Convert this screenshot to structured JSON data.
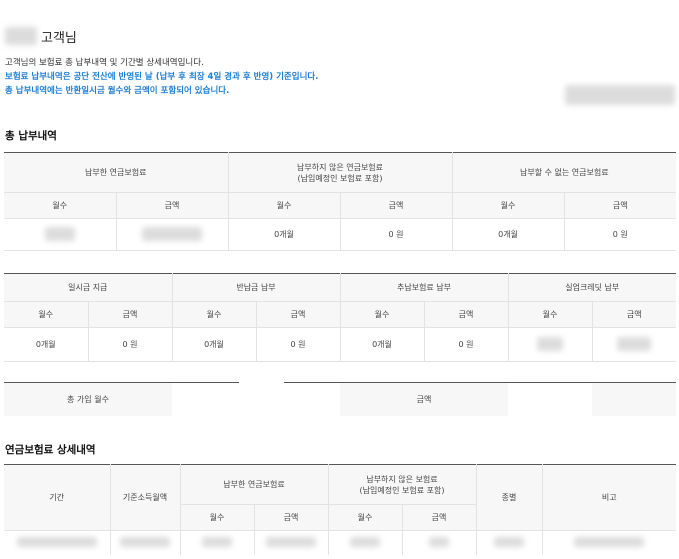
{
  "greeting": {
    "suffix": "고객님"
  },
  "intro": {
    "line1": "고객님의 보험료 총 납부내역 및 기간별 상세내역입니다.",
    "line2": "보험료 납부내역은 공단 전산에 반영된 날 (납부 후 최장 4일 경과 후 반영) 기준입니다.",
    "line3": "총 납부내역에는 반환일시금 월수와 금액이 포함되어 있습니다."
  },
  "total_section": {
    "title": "총 납부내역",
    "table1": {
      "groups": [
        "납부한 연금보험료",
        "납부하지 않은 연금보험료",
        "(납입예정인 보험료 포함)",
        "납부할 수 없는 연금보험료"
      ],
      "sub": {
        "months": "월수",
        "amount": "금액"
      },
      "values": {
        "unpaid_months": "0개월",
        "unpaid_amount": "0 원",
        "cannot_months": "0개월",
        "cannot_amount": "0 원"
      }
    },
    "table2": {
      "groups": [
        "일시금 지급",
        "반납금 납부",
        "추납보험료 납부",
        "실업크레딧 납부"
      ],
      "sub": {
        "months": "월수",
        "amount": "금액"
      },
      "values": {
        "lump_months": "0개월",
        "lump_amount": "0 원",
        "return_months": "0개월",
        "return_amount": "0 원",
        "extra_months": "0개월",
        "extra_amount": "0 원"
      }
    },
    "table3": {
      "total_months_label": "총 가입 월수",
      "amount_label": "금액"
    }
  },
  "detail_section": {
    "title": "연금보험료 상세내역",
    "headers": {
      "period": "기간",
      "base_income": "기준소득월액",
      "paid": "납부한 연금보험료",
      "unpaid": "납부하지 않은 보험료",
      "unpaid_sub": "(납입예정인 보험료 포함)",
      "type": "종별",
      "note": "비고",
      "months": "월수",
      "amount": "금액"
    }
  },
  "colors": {
    "accent_blue": "#1e7fd6",
    "header_bg": "#f7f7f7",
    "border": "#e3e3e3"
  }
}
